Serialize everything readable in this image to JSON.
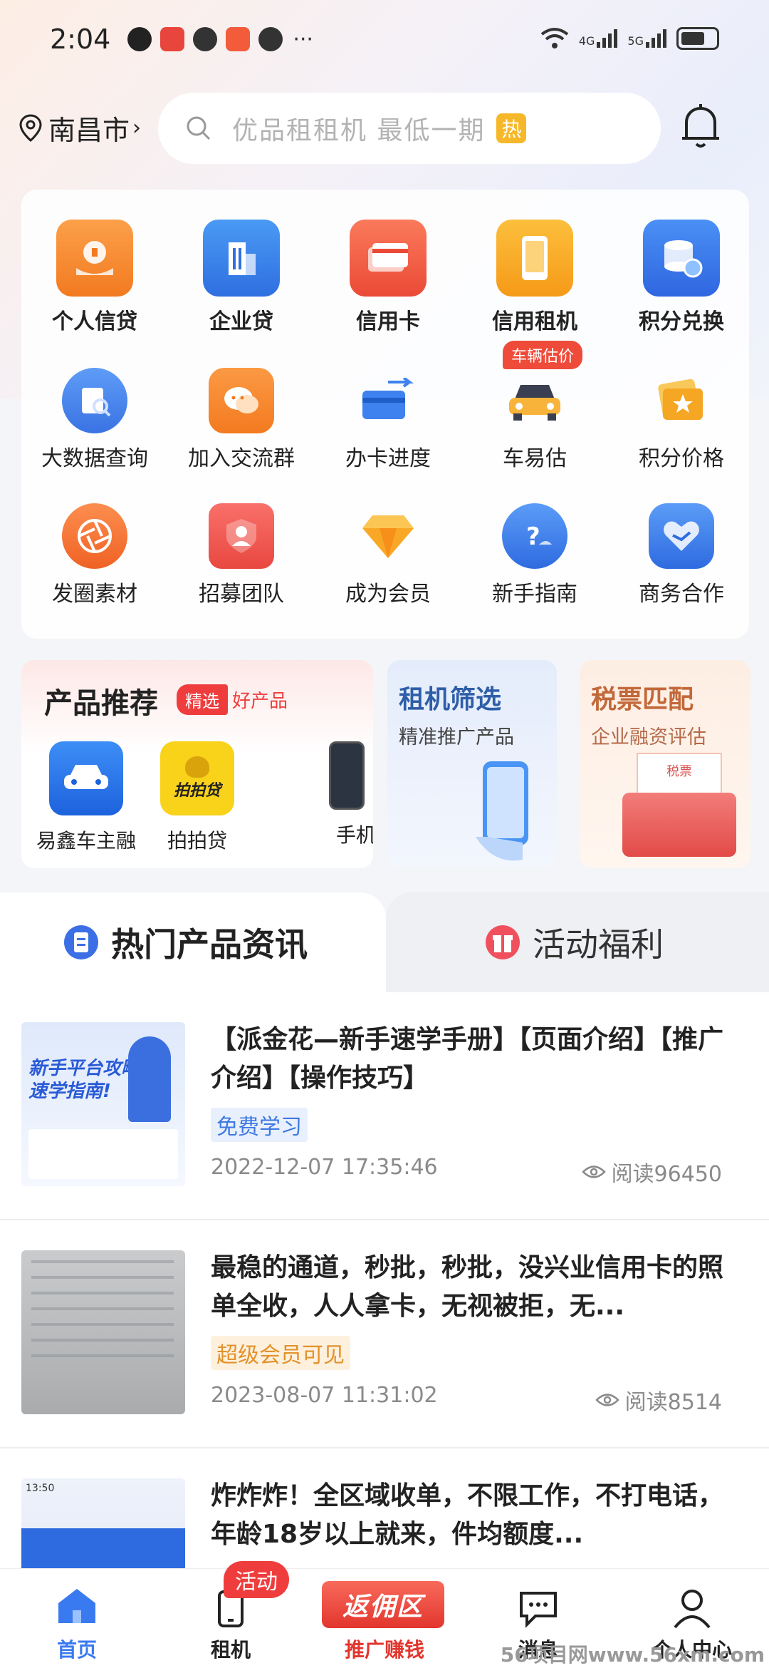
{
  "status_bar": {
    "time": "2:04",
    "dots": "···",
    "net1": "4G",
    "net2": "5G"
  },
  "header": {
    "city": "南昌市",
    "search_placeholder": "优品租租机 最低一期",
    "hot_badge": "热"
  },
  "grid": {
    "row1": [
      "个人信贷",
      "企业贷",
      "信用卡",
      "信用租机",
      "积分兑换"
    ],
    "row2": [
      "大数据查询",
      "加入交流群",
      "办卡进度",
      "车易估",
      "积分价格"
    ],
    "row3": [
      "发圈素材",
      "招募团队",
      "成为会员",
      "新手指南",
      "商务合作"
    ],
    "car_tag": "车辆估价"
  },
  "recommend": {
    "title": "产品推荐",
    "tag_selected": "精选",
    "tag_good": "好产品",
    "products": [
      "易鑫车主融",
      "拍拍贷",
      "手机租"
    ],
    "paipai_logo": "拍拍贷",
    "rent_title": "租机筛选",
    "rent_sub": "精准推广产品",
    "tax_title": "税票匹配",
    "tax_sub": "企业融资评估",
    "tax_doc": "税票"
  },
  "tabs": {
    "active": "热门产品资讯",
    "inactive": "活动福利"
  },
  "news": [
    {
      "title": "【派金花—新手速学手册】【页面介绍】【推广介绍】【操作技巧】",
      "tag": "免费学习",
      "date": "2022-12-07 17:35:46",
      "views": "阅读96450",
      "thumb_title": "新手平台攻略",
      "thumb_sub": "速学指南!"
    },
    {
      "title": "最稳的通道，秒批，秒批，没兴业信用卡的照单全收，人人拿卡，无视被拒，无...",
      "tag": "超级会员可见",
      "date": "2023-08-07 11:31:02",
      "views": "阅读8514"
    },
    {
      "title": "炸炸炸！全区域收单，不限工作，不打电话，年龄18岁以上就来，件均额度...",
      "thumb_time": "13:50"
    }
  ],
  "bottom_nav": {
    "home": "首页",
    "rent": "租机",
    "rent_badge": "活动",
    "promo_btn": "返佣区",
    "promo": "推广赚钱",
    "message": "消息",
    "profile": "个人中心"
  },
  "watermark": "56项目网www.56xm.com"
}
